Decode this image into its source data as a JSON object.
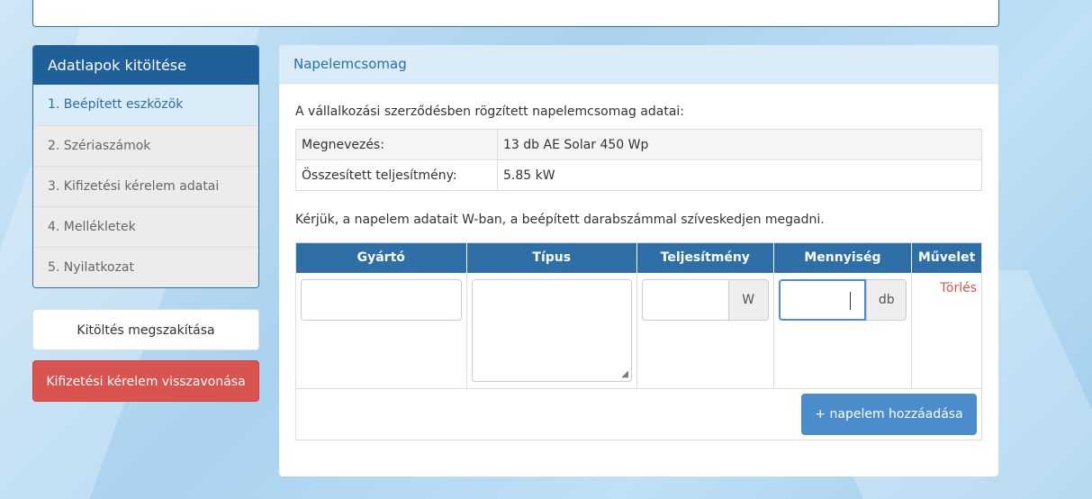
{
  "sidebar": {
    "title": "Adatlapok kitöltése",
    "items": [
      {
        "label": "1. Beépített eszközök"
      },
      {
        "label": "2. Szériaszámok"
      },
      {
        "label": "3. Kifizetési kérelem adatai"
      },
      {
        "label": "4. Mellékletek"
      },
      {
        "label": "5. Nyilatkozat"
      }
    ],
    "cancel_label": "Kitöltés megszakítása",
    "revoke_label": "Kifizetési kérelem visszavonása"
  },
  "panel": {
    "title": "Napelemcsomag",
    "intro": "A vállalkozási szerződésben rögzített napelemcsomag adatai:",
    "info": [
      {
        "label": "Megnevezés:",
        "value": "13 db AE Solar 450 Wp"
      },
      {
        "label": "Összesített teljesítmény:",
        "value": "5.85 kW"
      }
    ],
    "request": "Kérjük, a napelem adatait W-ban, a beépített darabszámmal szíveskedjen megadni.",
    "columns": [
      "Gyártó",
      "Típus",
      "Teljesítmény",
      "Mennyiség",
      "Művelet"
    ],
    "power_unit": "W",
    "qty_unit": "db",
    "delete_label": "Törlés",
    "add_label": "+ napelem hozzáadása"
  },
  "colors": {
    "primary": "#1f5f9a",
    "header_blue": "#2f6fa8",
    "danger": "#d9534f",
    "add_button": "#4b8ccc"
  }
}
